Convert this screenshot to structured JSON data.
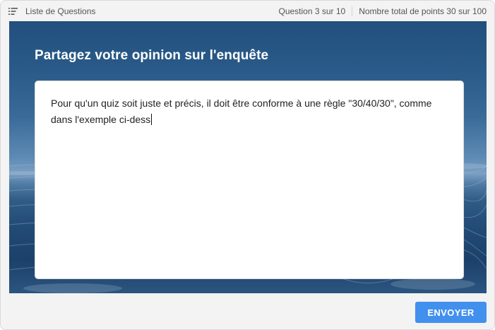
{
  "topbar": {
    "list_label": "Liste de Questions",
    "list_icon": "list-icon",
    "question_counter": "Question 3 sur 10",
    "points_total": "Nombre total de points 30 sur 100"
  },
  "question": {
    "title": "Partagez votre opinion sur l'enquête",
    "answer_value": "Pour qu'un quiz soit juste et précis, il doit être conforme à une règle \"30/40/30\", comme dans l'exemple ci-dess"
  },
  "footer": {
    "submit_label": "ENVOYER"
  },
  "colors": {
    "accent": "#4290ee",
    "background": "#f3f3f3",
    "ocean_dark": "#1c416a"
  }
}
